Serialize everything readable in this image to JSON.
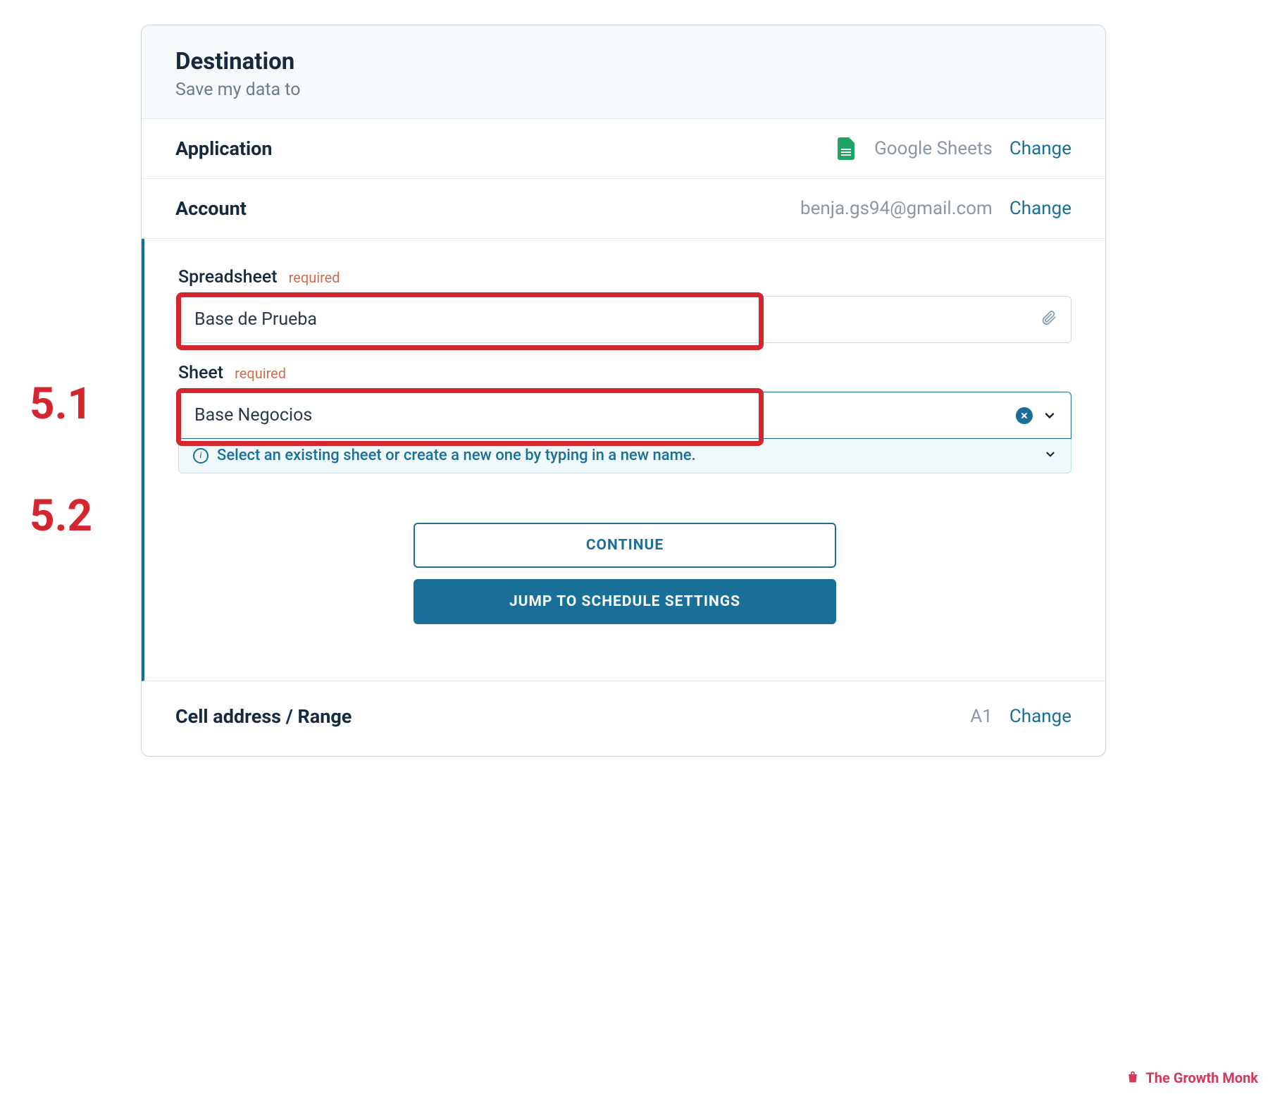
{
  "annotations": {
    "step_5_1": "5.1",
    "step_5_2": "5.2"
  },
  "header": {
    "title": "Destination",
    "subtitle": "Save my data to"
  },
  "application_row": {
    "label": "Application",
    "value": "Google Sheets",
    "change": "Change"
  },
  "account_row": {
    "label": "Account",
    "value": "benja.gs94@gmail.com",
    "change": "Change"
  },
  "spreadsheet": {
    "label": "Spreadsheet",
    "required": "required",
    "value": "Base de Prueba"
  },
  "sheet": {
    "label": "Sheet",
    "required": "required",
    "value": "Base Negocios",
    "hint": "Select an existing sheet or create a new one by typing in a new name."
  },
  "buttons": {
    "continue": "CONTINUE",
    "jump": "JUMP TO SCHEDULE SETTINGS"
  },
  "cell_range_row": {
    "label": "Cell address / Range",
    "value": "A1",
    "change": "Change"
  },
  "watermark": "The Growth Monk"
}
